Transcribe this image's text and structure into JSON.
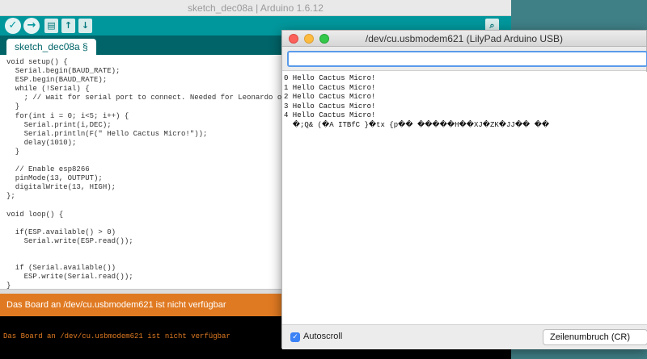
{
  "ide": {
    "title": "sketch_dec08a | Arduino 1.6.12",
    "toolbar": {
      "verify_icon": "check-icon",
      "upload_icon": "arrow-right-icon",
      "new_icon": "file-icon",
      "open_icon": "arrow-up-icon",
      "save_icon": "arrow-down-icon",
      "serial_monitor_icon": "magnifier-icon"
    },
    "tab_label": "sketch_dec08a §",
    "code_lines": [
      "void setup() {",
      "  Serial.begin(BAUD_RATE);",
      "  ESP.begin(BAUD_RATE);",
      "  while (!Serial) {",
      "    ; // wait for serial port to connect. Needed for Leonardo only",
      "  }",
      "  for(int i = 0; i<5; i++) {",
      "    Serial.print(i,DEC);",
      "    Serial.println(F(\" Hello Cactus Micro!\"));",
      "    delay(1010);",
      "  }",
      "",
      "  // Enable esp8266",
      "  pinMode(13, OUTPUT);",
      "  digitalWrite(13, HIGH);",
      "};",
      "",
      "void loop() {",
      "",
      "  if(ESP.available() > 0)",
      "    Serial.write(ESP.read());",
      "",
      "",
      "  if (Serial.available())",
      "    ESP.write(Serial.read());",
      "}"
    ],
    "status_message": "Das Board an /dev/cu.usbmodem621 ist nicht verfügbar",
    "console_message": "Das Board an /dev/cu.usbmodem621 ist nicht verfügbar",
    "colors": {
      "toolbar": "#00979c",
      "tabs_bar": "#006468",
      "status_bar": "#e07a22"
    }
  },
  "serial_monitor": {
    "title": "/dev/cu.usbmodem621 (LilyPad Arduino USB)",
    "input_value": "",
    "output_lines": [
      "0 Hello Cactus Micro!",
      "1 Hello Cactus Micro!",
      "2 Hello Cactus Micro!",
      "3 Hello Cactus Micro!",
      "4 Hello Cactus Micro!",
      "  �;Q& (�A ITBfC }�tx {p�� �����H��XJ�ZK�JJ�� ��"
    ],
    "autoscroll_label": "Autoscroll",
    "autoscroll_checked": true,
    "line_ending": "Zeilenumbruch (CR)"
  }
}
